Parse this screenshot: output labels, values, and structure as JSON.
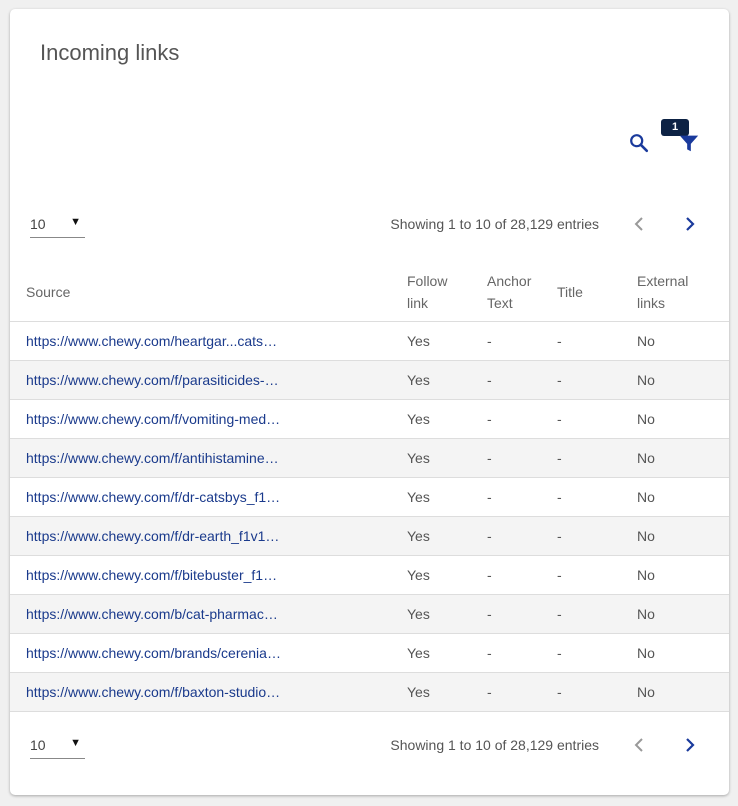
{
  "page": {
    "title": "Incoming links"
  },
  "toolbar": {
    "filter_badge": "1"
  },
  "pagination": {
    "page_size": "10",
    "showing": "Showing 1 to 10 of 28,129 entries"
  },
  "table": {
    "headers": {
      "source": "Source",
      "follow_1": "Follow",
      "follow_2": "link",
      "anchor_1": "Anchor",
      "anchor_2": "Text",
      "title": "Title",
      "external_1": "External",
      "external_2": "links"
    },
    "rows": [
      {
        "source": "https://www.chewy.com/heartgar...cats-…",
        "follow": "Yes",
        "anchor": "-",
        "title": "-",
        "external": "No"
      },
      {
        "source": "https://www.chewy.com/f/parasiticides-…",
        "follow": "Yes",
        "anchor": "-",
        "title": "-",
        "external": "No"
      },
      {
        "source": "https://www.chewy.com/f/vomiting-med…",
        "follow": "Yes",
        "anchor": "-",
        "title": "-",
        "external": "No"
      },
      {
        "source": "https://www.chewy.com/f/antihistamine…",
        "follow": "Yes",
        "anchor": "-",
        "title": "-",
        "external": "No"
      },
      {
        "source": "https://www.chewy.com/f/dr-catsbys_f1…",
        "follow": "Yes",
        "anchor": "-",
        "title": "-",
        "external": "No"
      },
      {
        "source": "https://www.chewy.com/f/dr-earth_f1v1…",
        "follow": "Yes",
        "anchor": "-",
        "title": "-",
        "external": "No"
      },
      {
        "source": "https://www.chewy.com/f/bitebuster_f1…",
        "follow": "Yes",
        "anchor": "-",
        "title": "-",
        "external": "No"
      },
      {
        "source": "https://www.chewy.com/b/cat-pharmac…",
        "follow": "Yes",
        "anchor": "-",
        "title": "-",
        "external": "No"
      },
      {
        "source": "https://www.chewy.com/brands/cerenia…",
        "follow": "Yes",
        "anchor": "-",
        "title": "-",
        "external": "No"
      },
      {
        "source": "https://www.chewy.com/f/baxton-studio…",
        "follow": "Yes",
        "anchor": "-",
        "title": "-",
        "external": "No"
      }
    ]
  },
  "icons": {
    "search": "search-icon",
    "filter": "filter-icon",
    "prev": "chevron-left-icon",
    "next": "chevron-right-icon",
    "caret": "caret-down-icon"
  },
  "colors": {
    "link": "#1a3a8c",
    "icon": "#1a3a9c",
    "badge": "#0d2244"
  }
}
